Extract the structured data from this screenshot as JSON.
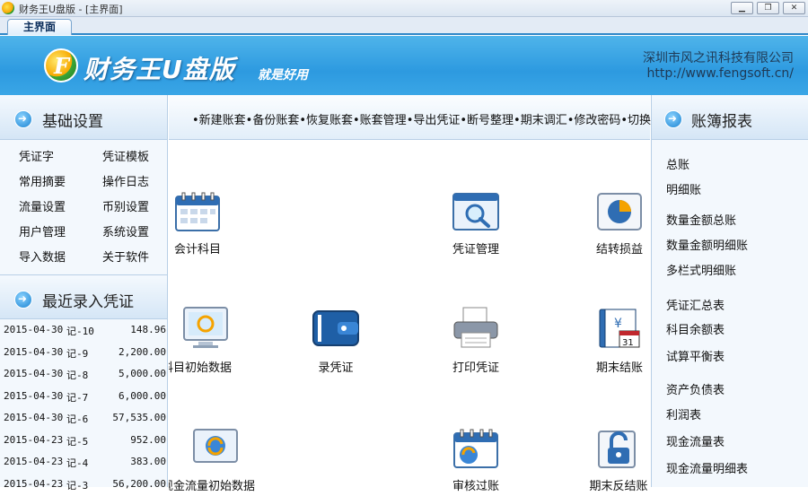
{
  "window": {
    "title": "财务王U盘版 - [主界面]",
    "min_label": "▁",
    "max_label": "❐",
    "close_label": "✕"
  },
  "tabs": {
    "main": "主界面"
  },
  "header": {
    "brand": "财务王U盘版",
    "slogan": "就是好用",
    "company": "深圳市风之讯科技有限公司",
    "url": "http://www.fengsoft.cn/",
    "logo_letter": "F"
  },
  "left": {
    "basic_title": "基础设置",
    "basic_items": [
      "凭证字",
      "凭证模板",
      "常用摘要",
      "操作日志",
      "流量设置",
      "币别设置",
      "用户管理",
      "系统设置",
      "导入数据",
      "关于软件"
    ],
    "recent_title": "最近录入凭证",
    "recent": [
      {
        "date": "2015-04-30",
        "no": "记-10",
        "amount": "148.96"
      },
      {
        "date": "2015-04-30",
        "no": "记-9",
        "amount": "2,200.00"
      },
      {
        "date": "2015-04-30",
        "no": "记-8",
        "amount": "5,000.00"
      },
      {
        "date": "2015-04-30",
        "no": "记-7",
        "amount": "6,000.00"
      },
      {
        "date": "2015-04-30",
        "no": "记-6",
        "amount": "57,535.00"
      },
      {
        "date": "2015-04-23",
        "no": "记-5",
        "amount": "952.00"
      },
      {
        "date": "2015-04-23",
        "no": "记-4",
        "amount": "383.00"
      },
      {
        "date": "2015-04-23",
        "no": "记-3",
        "amount": "56,200.00"
      }
    ]
  },
  "toolbar": {
    "items": [
      "•新建账套",
      "•备份账套",
      "•恢复账套",
      "•账套管理",
      "•导出凭证",
      "•断号整理",
      "•期末调汇",
      "•修改密码",
      "•切换账套"
    ]
  },
  "main": {
    "accounts": "会计科目",
    "voucher_mgmt": "凭证管理",
    "carry_forward": "结转损益",
    "init_data": "科目初始数据",
    "enter_voucher": "录凭证",
    "print_voucher": "打印凭证",
    "period_close": "期末结账",
    "cashflow_init": "现金流量初始数据",
    "audit": "审核过账",
    "reverse_close": "期末反结账",
    "calendar_num": "31"
  },
  "right": {
    "title": "账簿报表",
    "items": [
      "总账",
      "明细账",
      "数量金额总账",
      "数量金额明细账",
      "多栏式明细账",
      "凭证汇总表",
      "科目余额表",
      "试算平衡表",
      "资产负债表",
      "利润表",
      "现金流量表",
      "现金流量明细表"
    ]
  }
}
